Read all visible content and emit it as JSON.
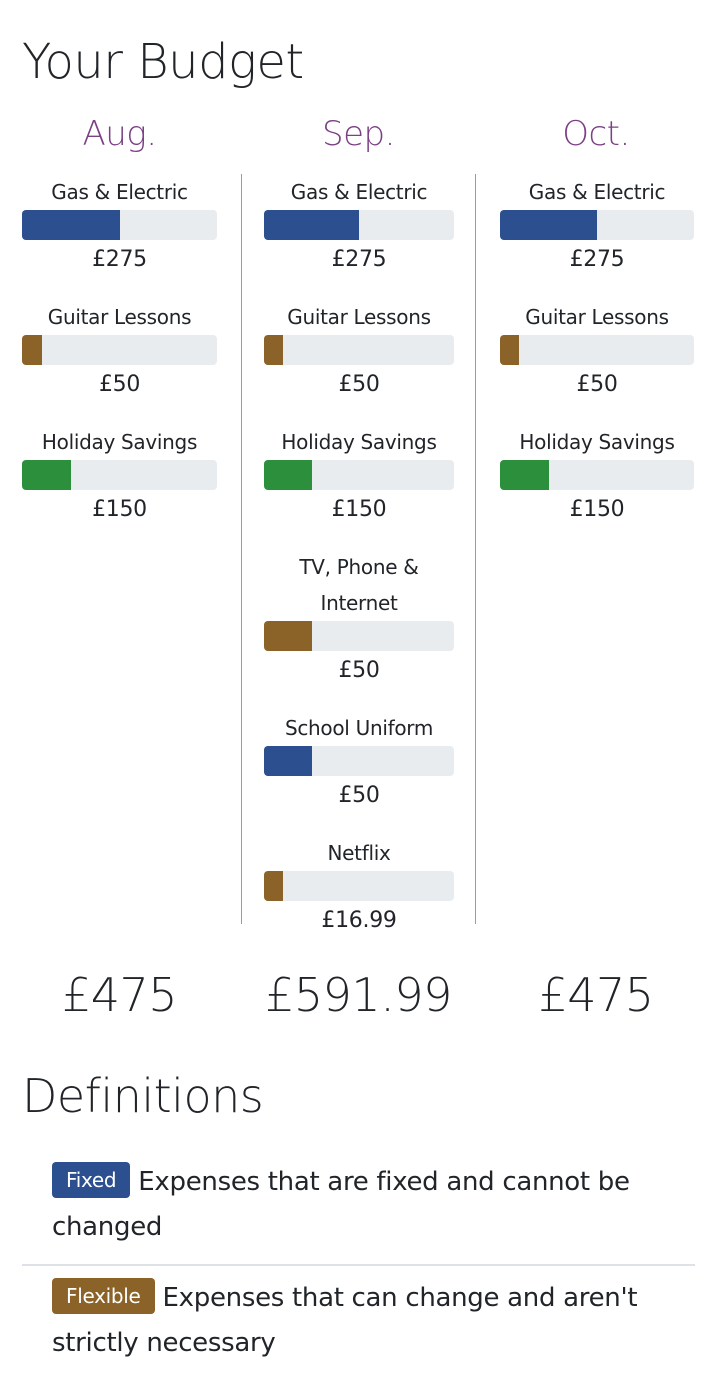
{
  "page_title": "Your Budget",
  "colors": {
    "fixed": "#2c4f8f",
    "flexible": "#8b6328",
    "savings": "#2b8f3c",
    "month_heading": "#7b3f84",
    "divider": "#b987bd",
    "track": "#e9ecef"
  },
  "months": [
    {
      "label": "Aug.",
      "total": "£475",
      "items": [
        {
          "name": "Gas & Electric",
          "amount": "£275",
          "category": "fixed",
          "fill_fraction": 0.5
        },
        {
          "name": "Guitar Lessons",
          "amount": "£50",
          "category": "flexible",
          "fill_fraction": 0.1
        },
        {
          "name": "Holiday Savings",
          "amount": "£150",
          "category": "savings",
          "fill_fraction": 0.25
        }
      ]
    },
    {
      "label": "Sep.",
      "total": "£591.99",
      "items": [
        {
          "name": "Gas & Electric",
          "amount": "£275",
          "category": "fixed",
          "fill_fraction": 0.5
        },
        {
          "name": "Guitar Lessons",
          "amount": "£50",
          "category": "flexible",
          "fill_fraction": 0.1
        },
        {
          "name": "Holiday Savings",
          "amount": "£150",
          "category": "savings",
          "fill_fraction": 0.25
        },
        {
          "name": "TV, Phone & Internet",
          "amount": "£50",
          "category": "flexible",
          "fill_fraction": 0.25
        },
        {
          "name": "School Uniform",
          "amount": "£50",
          "category": "fixed",
          "fill_fraction": 0.25
        },
        {
          "name": "Netflix",
          "amount": "£16.99",
          "category": "flexible",
          "fill_fraction": 0.1
        }
      ]
    },
    {
      "label": "Oct.",
      "total": "£475",
      "items": [
        {
          "name": "Gas & Electric",
          "amount": "£275",
          "category": "fixed",
          "fill_fraction": 0.5
        },
        {
          "name": "Guitar Lessons",
          "amount": "£50",
          "category": "flexible",
          "fill_fraction": 0.1
        },
        {
          "name": "Holiday Savings",
          "amount": "£150",
          "category": "savings",
          "fill_fraction": 0.25
        }
      ]
    }
  ],
  "definitions": {
    "title": "Definitions",
    "items": [
      {
        "badge": "Fixed",
        "category": "fixed",
        "text": "Expenses that are fixed and cannot be changed"
      },
      {
        "badge": "Flexible",
        "category": "flexible",
        "text": "Expenses that can change and aren't strictly necessary"
      }
    ]
  }
}
